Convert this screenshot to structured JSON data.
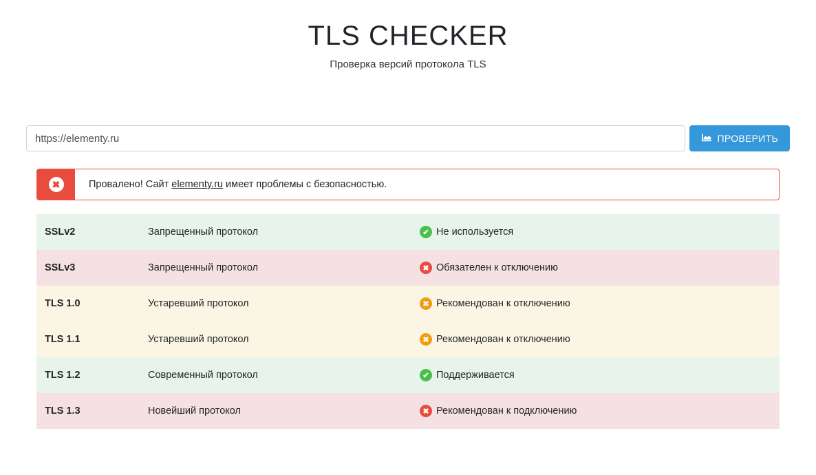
{
  "header": {
    "title": "TLS CHECKER",
    "subtitle": "Проверка версий протокола TLS"
  },
  "form": {
    "url_value": "https://elementy.ru",
    "button_label": "ПРОВЕРИТЬ"
  },
  "alert": {
    "prefix": "Провалено! Сайт ",
    "site": "elementy.ru",
    "suffix": " имеет проблемы с безопасностью."
  },
  "rows": [
    {
      "protocol": "SSLv2",
      "description": "Запрещенный протокол",
      "status_text": "Не используется",
      "state": "success"
    },
    {
      "protocol": "SSLv3",
      "description": "Запрещенный протокол",
      "status_text": "Обязателен к отключению",
      "state": "danger"
    },
    {
      "protocol": "TLS 1.0",
      "description": "Устаревший протокол",
      "status_text": "Рекомендован к отключению",
      "state": "warning"
    },
    {
      "protocol": "TLS 1.1",
      "description": "Устаревший протокол",
      "status_text": "Рекомендован к отключению",
      "state": "warning"
    },
    {
      "protocol": "TLS 1.2",
      "description": "Современный протокол",
      "status_text": "Поддерживается",
      "state": "success"
    },
    {
      "protocol": "TLS 1.3",
      "description": "Новейший протокол",
      "status_text": "Рекомендован к подключению",
      "state": "danger"
    }
  ]
}
